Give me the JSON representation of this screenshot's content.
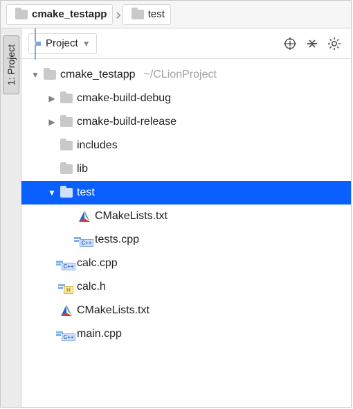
{
  "breadcrumb": [
    {
      "label": "cmake_testapp",
      "bold": true,
      "icon": "folder"
    },
    {
      "label": "test",
      "bold": false,
      "icon": "folder"
    }
  ],
  "sidebar_tab": {
    "label": "1: Project"
  },
  "panel": {
    "title": "Project",
    "actions": {
      "target": "target",
      "collapse": "collapse",
      "settings": "settings"
    }
  },
  "tree": {
    "root": {
      "label": "cmake_testapp",
      "hint": "~/CLionProject"
    },
    "items": [
      {
        "label": "cmake-build-debug",
        "type": "folder",
        "depth": 1,
        "expandable": true,
        "expanded": false
      },
      {
        "label": "cmake-build-release",
        "type": "folder",
        "depth": 1,
        "expandable": true,
        "expanded": false
      },
      {
        "label": "includes",
        "type": "folder",
        "depth": 1,
        "expandable": false
      },
      {
        "label": "lib",
        "type": "folder",
        "depth": 1,
        "expandable": false
      },
      {
        "label": "test",
        "type": "folder",
        "depth": 1,
        "expandable": true,
        "expanded": true,
        "selected": true
      },
      {
        "label": "CMakeLists.txt",
        "type": "cmake",
        "depth": 2
      },
      {
        "label": "tests.cpp",
        "type": "cpp",
        "depth": 2
      },
      {
        "label": "calc.cpp",
        "type": "cpp",
        "depth": 1
      },
      {
        "label": "calc.h",
        "type": "h",
        "depth": 1
      },
      {
        "label": "CMakeLists.txt",
        "type": "cmake",
        "depth": 1
      },
      {
        "label": "main.cpp",
        "type": "cpp",
        "depth": 1
      }
    ]
  }
}
